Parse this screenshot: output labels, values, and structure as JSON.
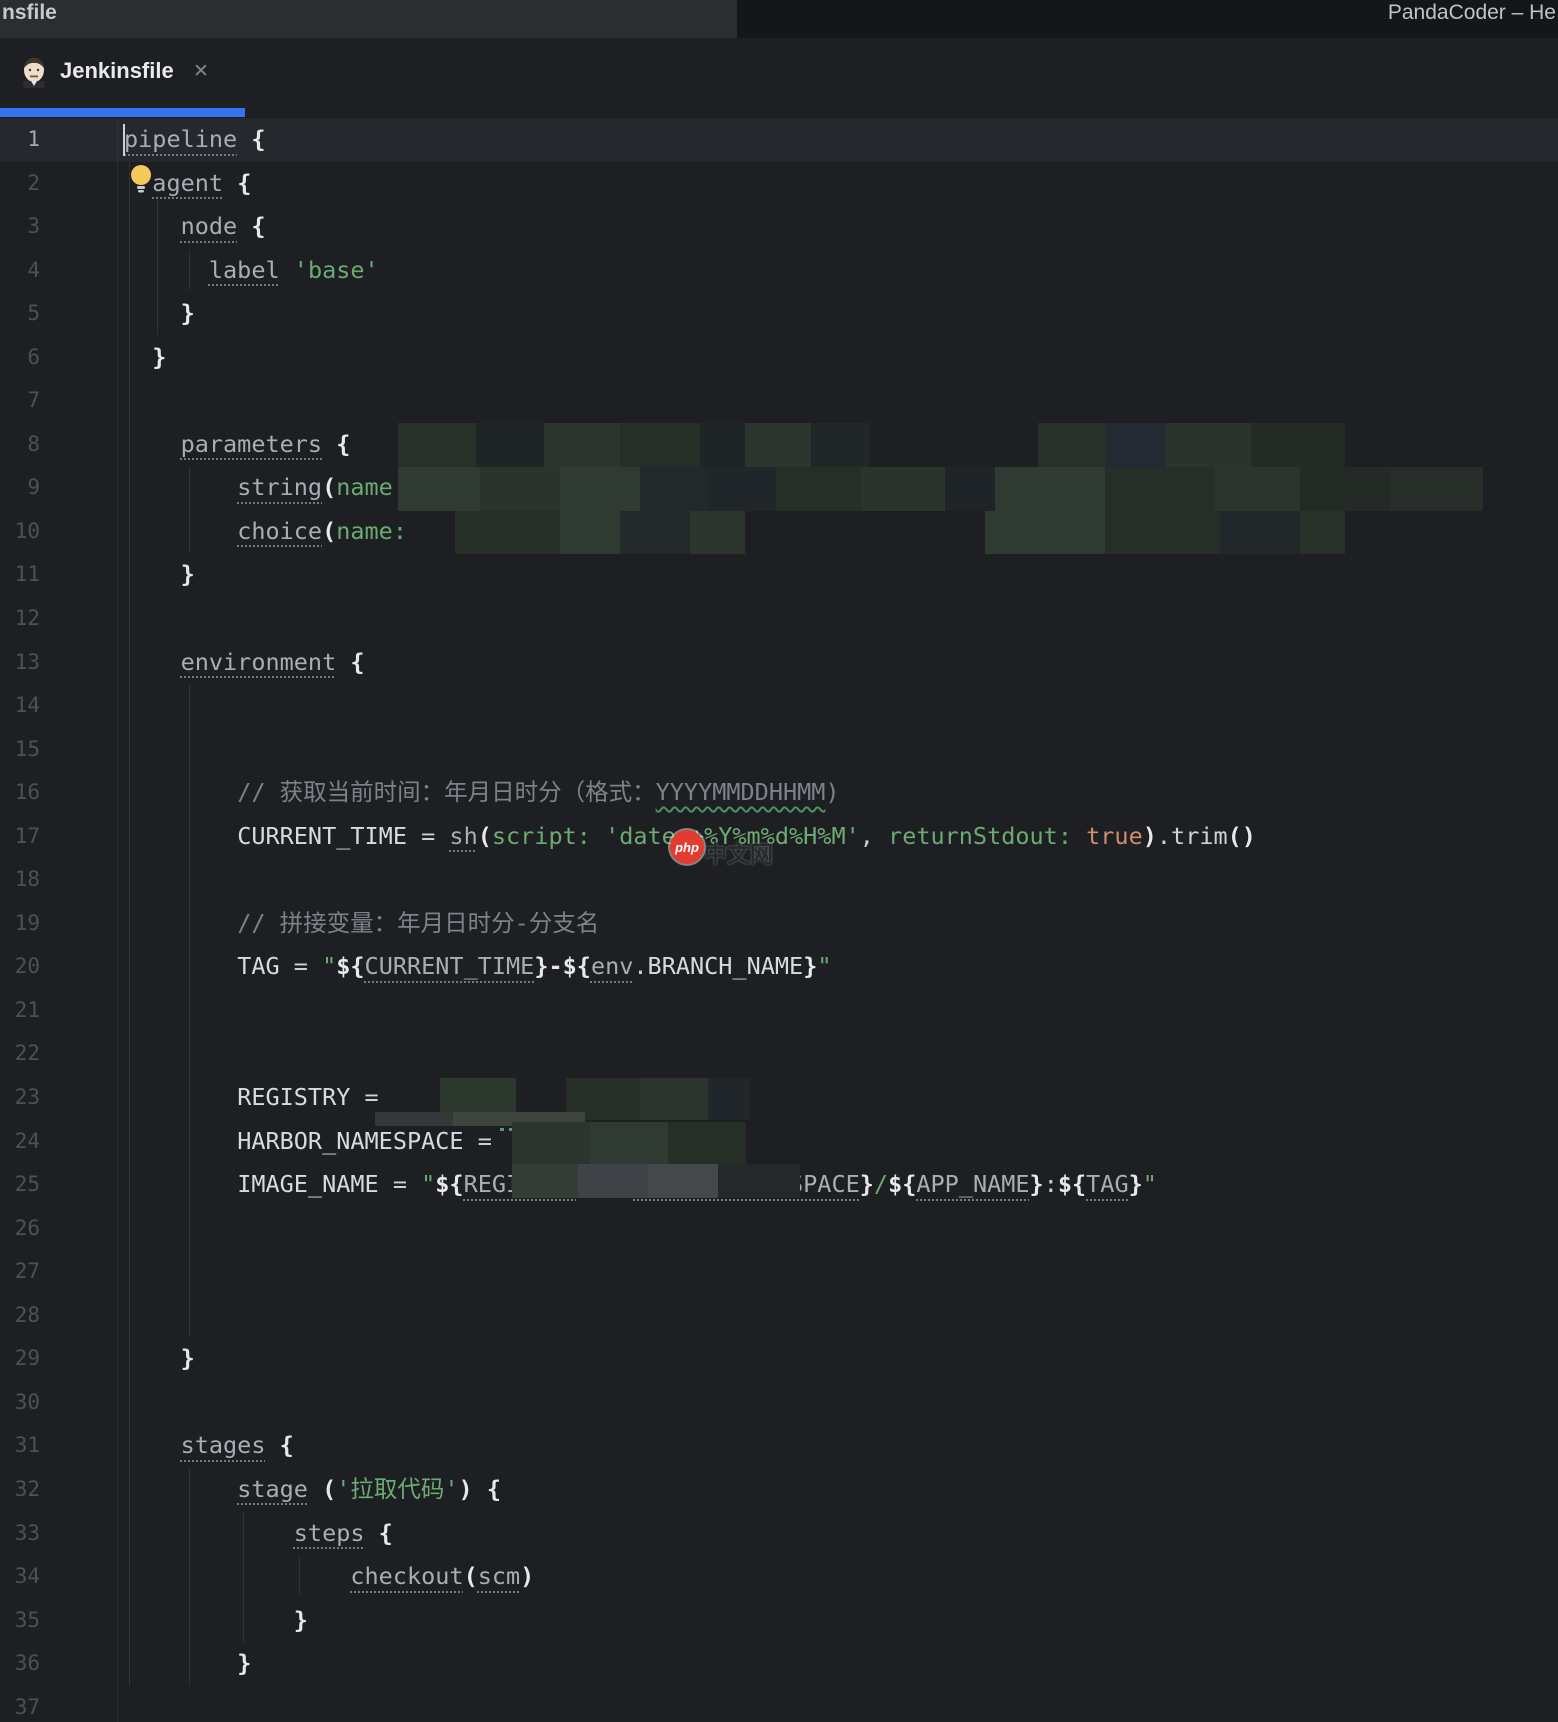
{
  "window": {
    "title_fragment": "nsfile",
    "plugin_title": "PandaCoder – He"
  },
  "tab_bar": {
    "active_tab": {
      "label": "Jenkinsfile",
      "close_glyph": "✕"
    }
  },
  "watermark": {
    "badge": "php",
    "label": "中文网"
  },
  "colors": {
    "accent_blue": "#3574f0",
    "string_green": "#6aab73",
    "keyword_orange": "#cf8e6d",
    "editor_bg": "#1e1f22"
  },
  "editor": {
    "line_count": 37,
    "lines": [
      {
        "cur": true,
        "s": [
          [
            "pipeline",
            "g",
            "d"
          ],
          [
            " {",
            "b"
          ]
        ]
      },
      {
        "s": [
          [
            "  ",
            "w"
          ],
          [
            "agent",
            "g",
            "d"
          ],
          [
            " {",
            "b"
          ]
        ]
      },
      {
        "s": [
          [
            "    ",
            "w"
          ],
          [
            "node",
            "g",
            "d"
          ],
          [
            " {",
            "b"
          ]
        ]
      },
      {
        "s": [
          [
            "      ",
            "w"
          ],
          [
            "label",
            "g",
            "d"
          ],
          [
            " ",
            "w"
          ],
          [
            "'base'",
            "s"
          ]
        ]
      },
      {
        "s": [
          [
            "    ",
            "w"
          ],
          [
            "}",
            "b"
          ]
        ]
      },
      {
        "s": [
          [
            "  ",
            "w"
          ],
          [
            "}",
            "b"
          ]
        ]
      },
      {
        "s": []
      },
      {
        "s": [
          [
            "    ",
            "w"
          ],
          [
            "parameters",
            "g",
            "d"
          ],
          [
            " {",
            "b"
          ]
        ]
      },
      {
        "s": [
          [
            "        ",
            "w"
          ],
          [
            "string",
            "g",
            "d"
          ],
          [
            "(",
            "b"
          ],
          [
            "name:",
            "s"
          ]
        ]
      },
      {
        "s": [
          [
            "        ",
            "w"
          ],
          [
            "choice",
            "g",
            "d"
          ],
          [
            "(",
            "b"
          ],
          [
            "name:",
            "s"
          ]
        ]
      },
      {
        "s": [
          [
            "    ",
            "w"
          ],
          [
            "}",
            "b"
          ]
        ]
      },
      {
        "s": []
      },
      {
        "s": [
          [
            "    ",
            "w"
          ],
          [
            "environment",
            "g",
            "d"
          ],
          [
            " {",
            "b"
          ]
        ]
      },
      {
        "s": []
      },
      {
        "s": []
      },
      {
        "s": [
          [
            "        ",
            "w"
          ],
          [
            "// 获取当前时间：年月日时分（格式：",
            "c"
          ],
          [
            "YYYYMMDDHHMM",
            "c",
            "w"
          ],
          [
            ")",
            "c"
          ]
        ]
      },
      {
        "s": [
          [
            "        ",
            "w"
          ],
          [
            "CURRENT_TIME",
            "v"
          ],
          [
            " = ",
            "w"
          ],
          [
            "sh",
            "g",
            "d"
          ],
          [
            "(",
            "b"
          ],
          [
            "script:",
            "s"
          ],
          [
            " ",
            "w"
          ],
          [
            "'date +%Y%m%d%H%M'",
            "s"
          ],
          [
            ", ",
            "w"
          ],
          [
            "returnStdout:",
            "s"
          ],
          [
            " ",
            "w"
          ],
          [
            "true",
            "k"
          ],
          [
            ")",
            "b"
          ],
          [
            ".",
            "w"
          ],
          [
            "trim",
            "w"
          ],
          [
            "()",
            "b"
          ]
        ]
      },
      {
        "s": []
      },
      {
        "s": [
          [
            "        ",
            "w"
          ],
          [
            "// 拼接变量：年月日时分-分支名",
            "c"
          ]
        ]
      },
      {
        "s": [
          [
            "        ",
            "w"
          ],
          [
            "TAG",
            "v"
          ],
          [
            " = ",
            "w"
          ],
          [
            "\"",
            "s"
          ],
          [
            "${",
            "b"
          ],
          [
            "CURRENT_TIME",
            "g",
            "d"
          ],
          [
            "}",
            "b"
          ],
          [
            "-",
            "b"
          ],
          [
            "${",
            "b"
          ],
          [
            "env",
            "g",
            "d"
          ],
          [
            ".",
            "w"
          ],
          [
            "BRANCH_NAME",
            "v"
          ],
          [
            "}",
            "b"
          ],
          [
            "\"",
            "s"
          ]
        ]
      },
      {
        "s": []
      },
      {
        "s": []
      },
      {
        "s": [
          [
            "        ",
            "w"
          ],
          [
            "REGISTRY",
            "v"
          ],
          [
            " =",
            "w"
          ]
        ]
      },
      {
        "s": [
          [
            "        ",
            "w"
          ],
          [
            "HARBOR_NAMESPACE",
            "v"
          ],
          [
            " =",
            "w"
          ]
        ]
      },
      {
        "s": [
          [
            "        ",
            "w"
          ],
          [
            "IMAGE_NAME",
            "v"
          ],
          [
            " = ",
            "w"
          ],
          [
            "\"",
            "s"
          ],
          [
            "${",
            "b"
          ],
          [
            "REGISTRY",
            "g",
            "d"
          ],
          [
            "}",
            "b"
          ],
          [
            "/",
            "s"
          ],
          [
            "${",
            "b"
          ],
          [
            "HARBOR_NAMESPACE",
            "g",
            "d"
          ],
          [
            "}",
            "b"
          ],
          [
            "/",
            "s"
          ],
          [
            "${",
            "b"
          ],
          [
            "APP_NAME",
            "g",
            "d"
          ],
          [
            "}",
            "b"
          ],
          [
            ":",
            "w"
          ],
          [
            "${",
            "b"
          ],
          [
            "TAG",
            "g",
            "d"
          ],
          [
            "}",
            "b"
          ],
          [
            "\"",
            "s"
          ]
        ]
      },
      {
        "s": []
      },
      {
        "s": []
      },
      {
        "s": []
      },
      {
        "s": [
          [
            "    ",
            "w"
          ],
          [
            "}",
            "b"
          ]
        ]
      },
      {
        "s": []
      },
      {
        "s": [
          [
            "    ",
            "w"
          ],
          [
            "stages",
            "g",
            "d"
          ],
          [
            " {",
            "b"
          ]
        ]
      },
      {
        "s": [
          [
            "        ",
            "w"
          ],
          [
            "stage",
            "g",
            "d"
          ],
          [
            " (",
            "b"
          ],
          [
            "'拉取代码'",
            "s"
          ],
          [
            ")",
            "b"
          ],
          [
            " {",
            "b"
          ]
        ]
      },
      {
        "s": [
          [
            "            ",
            "w"
          ],
          [
            "steps",
            "g",
            "d"
          ],
          [
            " {",
            "b"
          ]
        ]
      },
      {
        "s": [
          [
            "                ",
            "w"
          ],
          [
            "checkout",
            "g",
            "d"
          ],
          [
            "(",
            "b"
          ],
          [
            "scm",
            "g",
            "d"
          ],
          [
            ")",
            "b"
          ]
        ]
      },
      {
        "s": [
          [
            "            ",
            "w"
          ],
          [
            "}",
            "b"
          ]
        ]
      },
      {
        "s": [
          [
            "        ",
            "w"
          ],
          [
            "}",
            "b"
          ]
        ]
      },
      {
        "s": []
      }
    ]
  }
}
